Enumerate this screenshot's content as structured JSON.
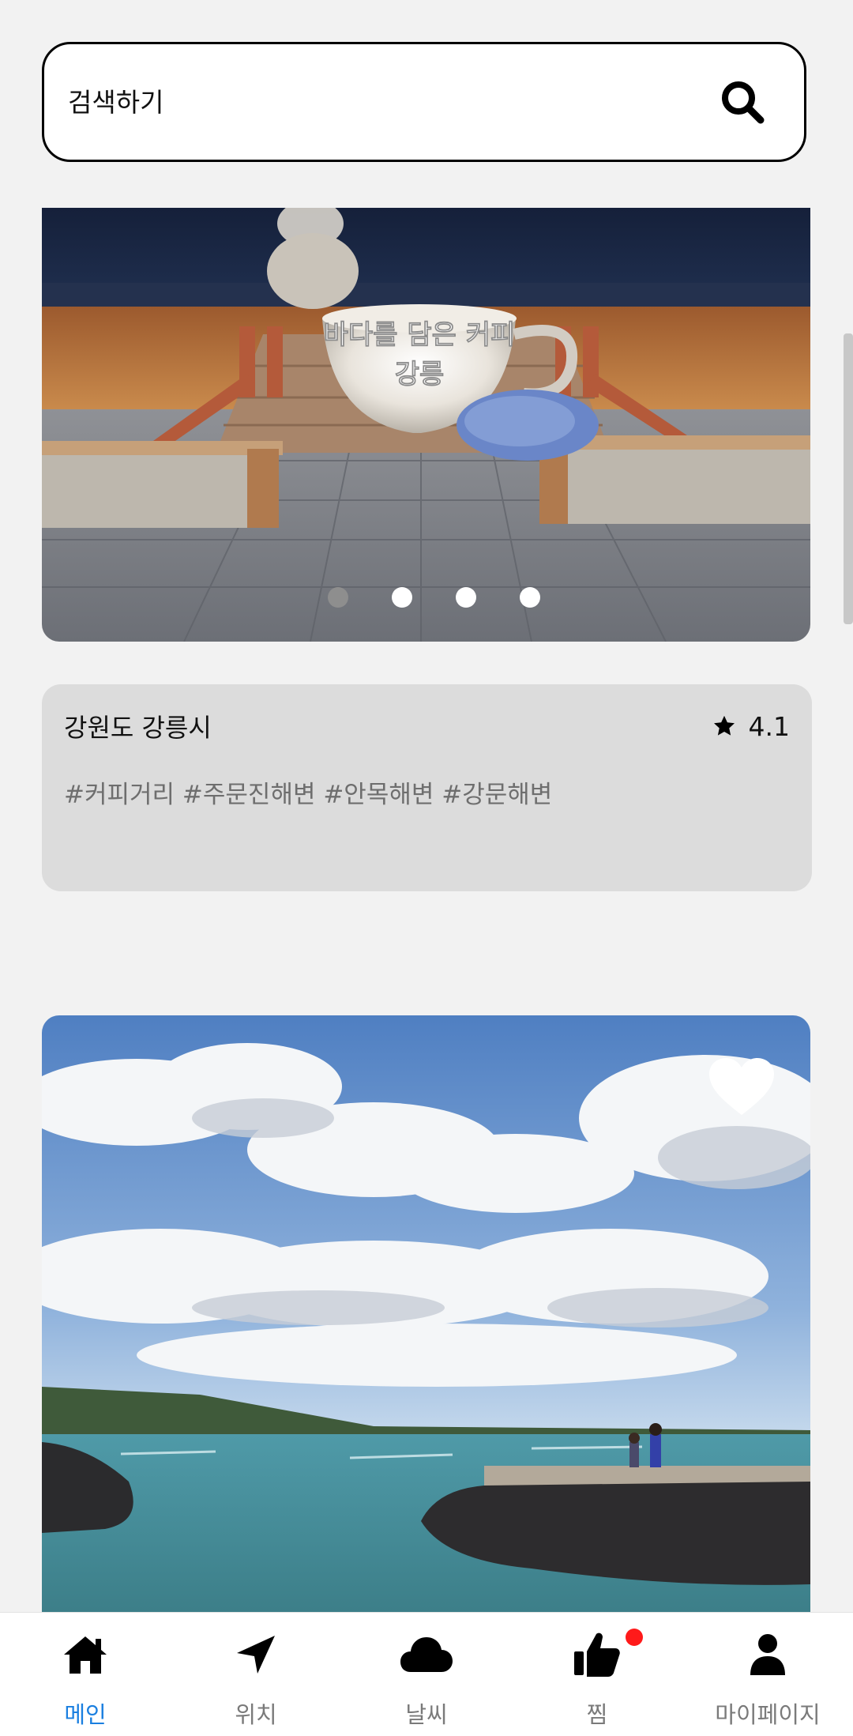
{
  "search": {
    "placeholder": "검색하기"
  },
  "banner": {
    "sign_text_line1": "바다를 담은 커피",
    "sign_text_line2": "강릉",
    "slide_count": 4,
    "active_slide": 1
  },
  "place": {
    "region": "강원도 강릉시",
    "rating": "4.1",
    "tags": "#커피거리 #주문진해변 #안목해변 #강문해변"
  },
  "nav": {
    "items": [
      {
        "label": "메인",
        "icon": "home-icon",
        "active": true
      },
      {
        "label": "위치",
        "icon": "location-arrow-icon",
        "active": false
      },
      {
        "label": "날씨",
        "icon": "cloud-icon",
        "active": false
      },
      {
        "label": "찜",
        "icon": "thumbs-up-icon",
        "active": false
      },
      {
        "label": "마이페이지",
        "icon": "user-icon",
        "active": false
      }
    ]
  },
  "colors": {
    "accent": "#1a7fe0",
    "notification": "#ff1a1a",
    "card_bg": "#dcdcdc",
    "page_bg": "#f2f2f2"
  }
}
